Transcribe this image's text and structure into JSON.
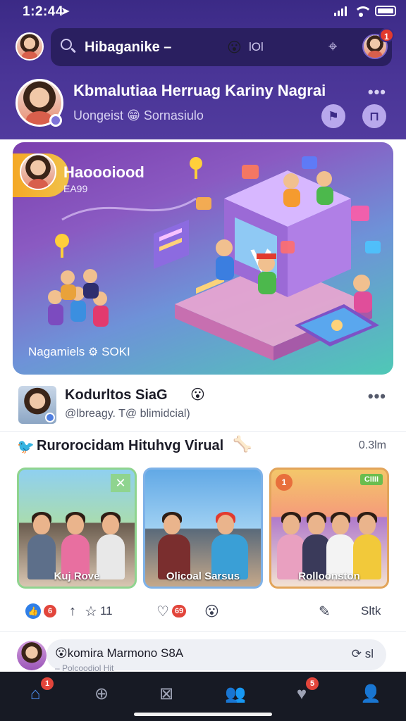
{
  "status": {
    "time": "1:2:44",
    "location_glyph": "➤"
  },
  "search": {
    "text": "Hibaganike –",
    "emoji": "😮",
    "count": "lOl"
  },
  "messages_badge": "1",
  "profile": {
    "name": "Kbmalutiaa Herruag Kariny Nagrai",
    "subtitle_left": "Uongeist",
    "subtitle_emoji": "😁",
    "subtitle_right": "Sornasiulo",
    "more": "•••"
  },
  "hero": {
    "title": "Haoooiood",
    "subtitle": "EA99",
    "footer_text": "Nagamiels",
    "footer_icon": "⚙",
    "footer_count": "SOKI",
    "colors": {
      "start": "#7b3fae",
      "end": "#4fc8b6"
    }
  },
  "post": {
    "name": "Kodurltos SiaG",
    "emoji": "😮",
    "handle": "@lbreagy. T@ blimidcial)",
    "more": "•••"
  },
  "section": {
    "bird": "🐦",
    "title": "Rurorocidam Hituhvg Virual",
    "emoji": "🦴",
    "count": "0.3lm"
  },
  "cards": [
    {
      "label": "Kuj Rove",
      "corner": "✕"
    },
    {
      "label": "Olicoal Sarsus"
    },
    {
      "label": "Rolloonston",
      "tag": "CIIII",
      "circle": "1"
    }
  ],
  "actions": {
    "like_badge": "6",
    "repost_icon": "↑",
    "star_count": "11",
    "heart_badge": "69",
    "emoji": "😮",
    "share_label": "Sltk"
  },
  "comment": {
    "text": "😮komira Marmono S8A",
    "subtext": "– Polcoodiol Hit",
    "right_text": "sl"
  },
  "nav": {
    "home_badge": "1",
    "notif_badge": "5"
  }
}
